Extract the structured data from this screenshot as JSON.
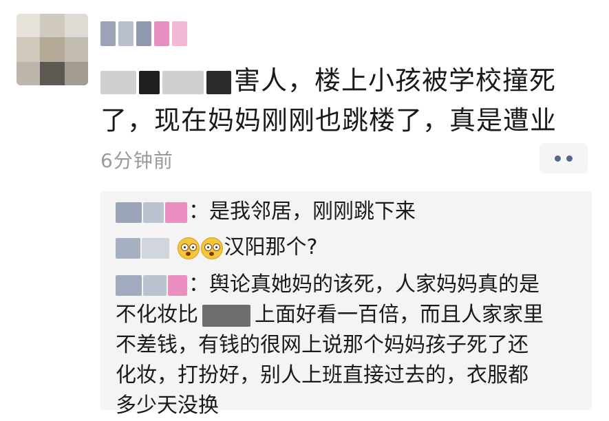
{
  "post": {
    "text_line1_visible": "害人，楼上小孩被学校撞死",
    "text_line2": "了，现在妈妈刚刚也跳楼了，真是遭业",
    "time": "6分钟前"
  },
  "comments": [
    {
      "text": "：是我邻居，刚刚跳下来"
    },
    {
      "text": "汉阳那个?"
    },
    {
      "line1": "：舆论真她妈的该死，人家妈妈真的是",
      "line2a": "不化妆比",
      "line2b": "上面好看一百倍，而且人家家里",
      "line3": "不差钱，有钱的很网上说那个妈妈孩子死了还",
      "line4": "化妆，打扮好，别人上班直接过去的，衣服都",
      "line5": "多少天没换"
    }
  ],
  "icons": {
    "more": "more-dots-icon",
    "emoji": "shocked-face-emoji-icon"
  },
  "colors": {
    "text": "#1a1a1a",
    "time": "#9a9a9a",
    "comment_bg": "#f4f4f4",
    "more_dots": "#56678c"
  }
}
